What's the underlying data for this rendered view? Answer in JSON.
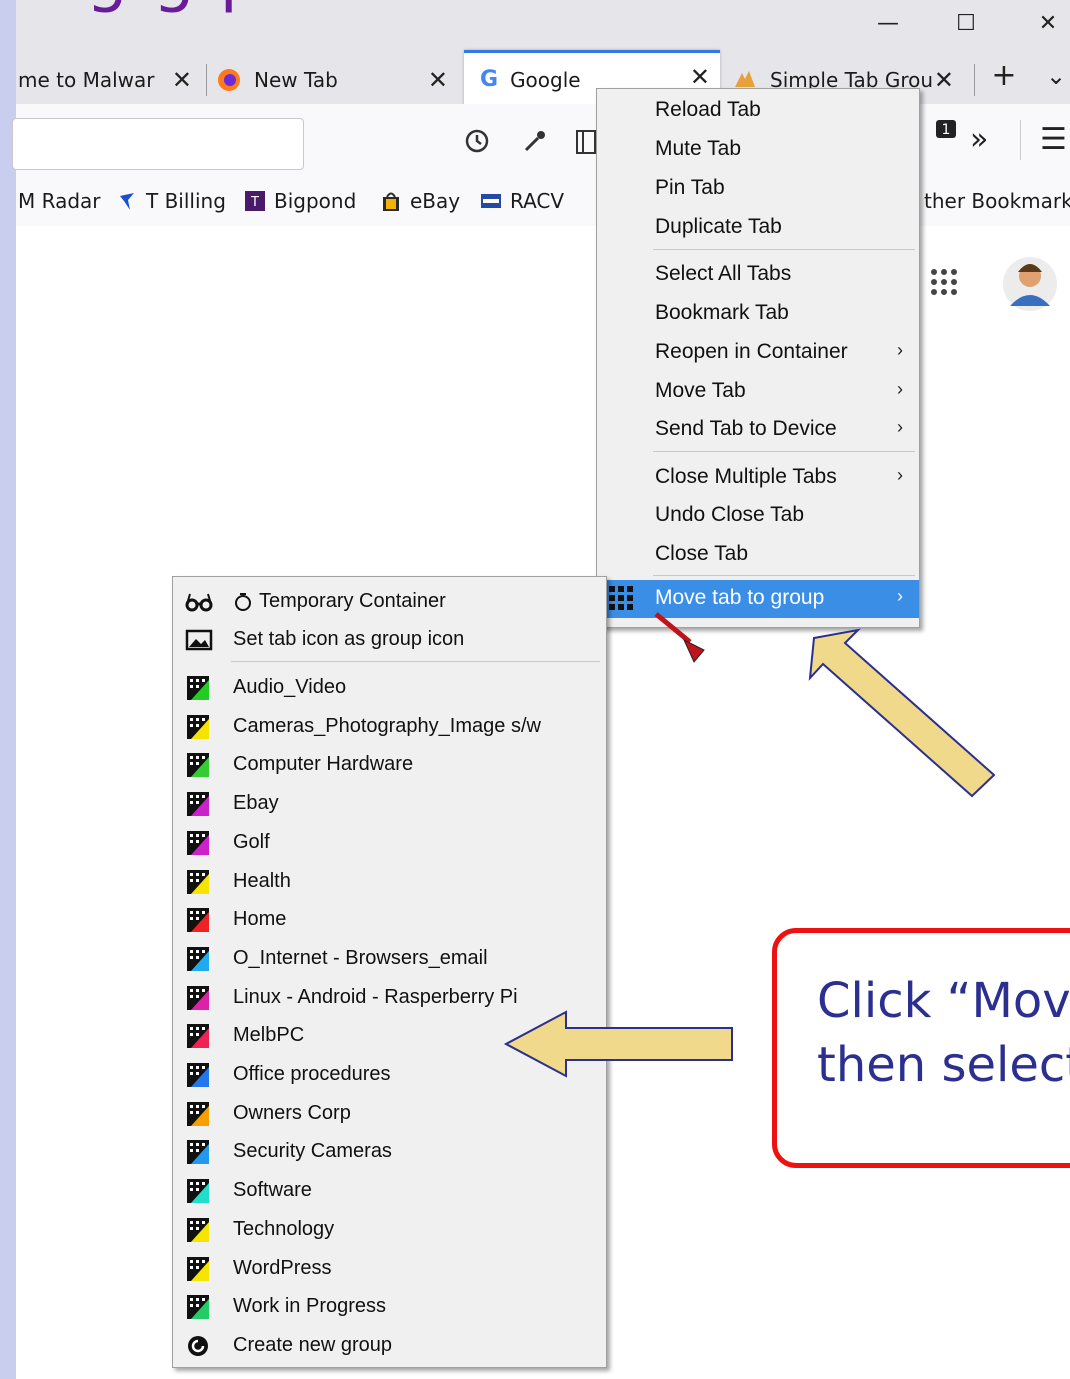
{
  "slide": {
    "title_fragment": "g               g  p",
    "callout_line1": "Click “Move",
    "callout_line2": "then select"
  },
  "window": {
    "controls": [
      "—",
      "☐",
      "✕"
    ]
  },
  "tabs": [
    {
      "label": "me to Malwar",
      "close": "✕"
    },
    {
      "label": "New Tab",
      "close": "✕"
    },
    {
      "label": "Google",
      "close": "✕"
    },
    {
      "label": "Simple Tab Grou",
      "close": "✕"
    }
  ],
  "tabbar": {
    "new_tab": "+",
    "list_tabs": "⌄"
  },
  "toolbar": {
    "overflow": "»",
    "menu": "☰"
  },
  "bookmarks": [
    {
      "label": "M Radar"
    },
    {
      "label": "T Billing"
    },
    {
      "label": "Bigpond"
    },
    {
      "label": "eBay"
    },
    {
      "label": "RACV"
    },
    {
      "label": "ther Bookmarks"
    }
  ],
  "context_menu": {
    "items": [
      {
        "label": "Reload Tab",
        "submenu": false
      },
      {
        "label": "Mute Tab",
        "submenu": false
      },
      {
        "label": "Pin Tab",
        "submenu": false
      },
      {
        "label": "Duplicate Tab",
        "submenu": false
      },
      {
        "label": "Select All Tabs",
        "submenu": false
      },
      {
        "label": "Bookmark Tab",
        "submenu": false
      },
      {
        "label": "Reopen in Container",
        "submenu": true
      },
      {
        "label": "Move Tab",
        "submenu": true
      },
      {
        "label": "Send Tab to Device",
        "submenu": true
      },
      {
        "label": "Close Multiple Tabs",
        "submenu": true
      },
      {
        "label": "Undo Close Tab",
        "submenu": false
      },
      {
        "label": "Close Tab",
        "submenu": false
      },
      {
        "label": "Move tab to group",
        "submenu": true,
        "highlighted": true
      }
    ],
    "arrow": "›",
    "highlight_color": "#3a8ee6"
  },
  "group_menu": {
    "top_items": [
      {
        "label": "Temporary Container",
        "icon": "glasses-icon"
      },
      {
        "label": "Set tab icon as group icon",
        "icon": "image-icon"
      }
    ],
    "groups": [
      {
        "label": "Audio_Video",
        "color": "#22cc22"
      },
      {
        "label": "Cameras_Photography_Image s/w",
        "color": "#f5e400"
      },
      {
        "label": "Computer Hardware",
        "color": "#33cc33"
      },
      {
        "label": "Ebay",
        "color": "#cc22cc"
      },
      {
        "label": "Golf",
        "color": "#cc22cc"
      },
      {
        "label": "Health",
        "color": "#f5e400"
      },
      {
        "label": "Home",
        "color": "#ee2222"
      },
      {
        "label": "O_Internet - Browsers_email",
        "color": "#22aaee"
      },
      {
        "label": "Linux - Android - Rasperberry Pi",
        "color": "#dd22aa"
      },
      {
        "label": "MelbPC",
        "color": "#ee2255"
      },
      {
        "label": "Office procedures",
        "color": "#2277ee"
      },
      {
        "label": "Owners Corp",
        "color": "#f5a000"
      },
      {
        "label": "Security Cameras",
        "color": "#2299ee"
      },
      {
        "label": "Software",
        "color": "#22ddcc"
      },
      {
        "label": "Technology",
        "color": "#f5e400"
      },
      {
        "label": "WordPress",
        "color": "#f5e400"
      },
      {
        "label": "Work in Progress",
        "color": "#22cc66"
      }
    ],
    "create_label": "Create new group"
  }
}
